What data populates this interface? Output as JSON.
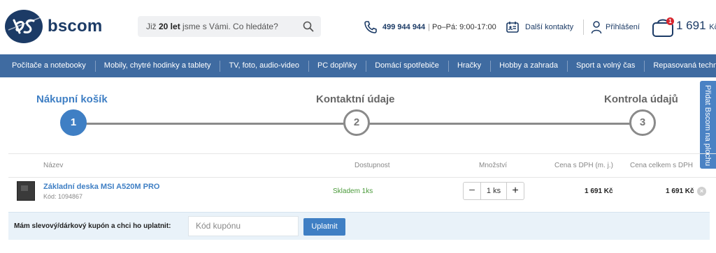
{
  "header": {
    "logo_text": "bscom",
    "search": {
      "prefix": "Již ",
      "bold": "20 let",
      "suffix": " jsme s Vámi. Co hledáte?"
    },
    "phone": {
      "number": "499 944 944",
      "hours": "Po–Pá: 9:00-17:00"
    },
    "contacts_label": "Další kontakty",
    "login_label": "Přihlášení",
    "cart": {
      "badge": "1",
      "total": "1 691",
      "currency": "Kč"
    }
  },
  "nav": {
    "items": [
      "Počítače a notebooky",
      "Mobily, chytré hodinky a tablety",
      "TV, foto, audio-video",
      "PC doplňky",
      "Domácí spotřebiče",
      "Hračky",
      "Hobby a zahrada",
      "Sport a volný čas",
      "Repasovaná technika"
    ]
  },
  "steps": [
    {
      "label": "Nákupní košík",
      "number": "1"
    },
    {
      "label": "Kontaktní údaje",
      "number": "2"
    },
    {
      "label": "Kontrola údajů",
      "number": "3"
    }
  ],
  "sidetab_label": "Přidat Bscom na plochu",
  "table": {
    "headers": {
      "name": "Název",
      "availability": "Dostupnost",
      "quantity": "Množství",
      "unit_price": "Cena s DPH (m. j.)",
      "total_price": "Cena celkem s DPH"
    },
    "row": {
      "name": "Základní deska MSI A520M PRO",
      "code": "Kód: 1094867",
      "availability": "Skladem 1ks",
      "quantity": "1 ks",
      "minus": "−",
      "plus": "+",
      "unit_price": "1 691 Kč",
      "total_price": "1 691 Kč",
      "remove": "×"
    }
  },
  "coupon": {
    "label": "Mám slevový/dárkový kupón a chci ho uplatnit:",
    "placeholder": "Kód kupónu",
    "button": "Uplatnit"
  },
  "colors": {
    "brand": "#1c3b66",
    "nav_bg": "#3f6ba1",
    "accent": "#3f7fc4",
    "in_stock": "#4a9a3a"
  }
}
